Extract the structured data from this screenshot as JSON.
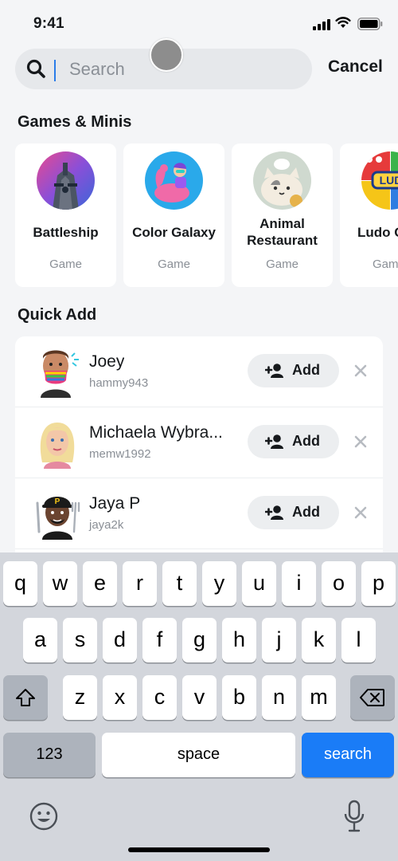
{
  "status": {
    "time": "9:41"
  },
  "search": {
    "placeholder": "Search",
    "value": "",
    "cancel_label": "Cancel"
  },
  "sections": {
    "games": "Games & Minis",
    "quick_add": "Quick Add"
  },
  "games": [
    {
      "name": "Battleship",
      "kind": "Game",
      "icon": "battleship-icon"
    },
    {
      "name": "Color Galaxy",
      "kind": "Game",
      "icon": "color-galaxy-icon"
    },
    {
      "name": "Animal Restaurant",
      "kind": "Game",
      "icon": "animal-restaurant-icon"
    },
    {
      "name": "Ludo C",
      "kind": "Gam",
      "icon": "ludo-icon"
    }
  ],
  "quick_add": [
    {
      "name": "Joey",
      "username": "hammy943",
      "add_label": "Add"
    },
    {
      "name": "Michaela Wybra...",
      "username": "memw1992",
      "add_label": "Add"
    },
    {
      "name": "Jaya P",
      "username": "jaya2k",
      "add_label": "Add"
    }
  ],
  "keyboard": {
    "row1": [
      "q",
      "w",
      "e",
      "r",
      "t",
      "y",
      "u",
      "i",
      "o",
      "p"
    ],
    "row2": [
      "a",
      "s",
      "d",
      "f",
      "g",
      "h",
      "j",
      "k",
      "l"
    ],
    "row3": [
      "z",
      "x",
      "c",
      "v",
      "b",
      "n",
      "m"
    ],
    "numbers_label": "123",
    "space_label": "space",
    "action_label": "search"
  },
  "colors": {
    "accent": "#1a7cf7",
    "background": "#f4f5f7",
    "keyboard": "#d3d6dc"
  }
}
